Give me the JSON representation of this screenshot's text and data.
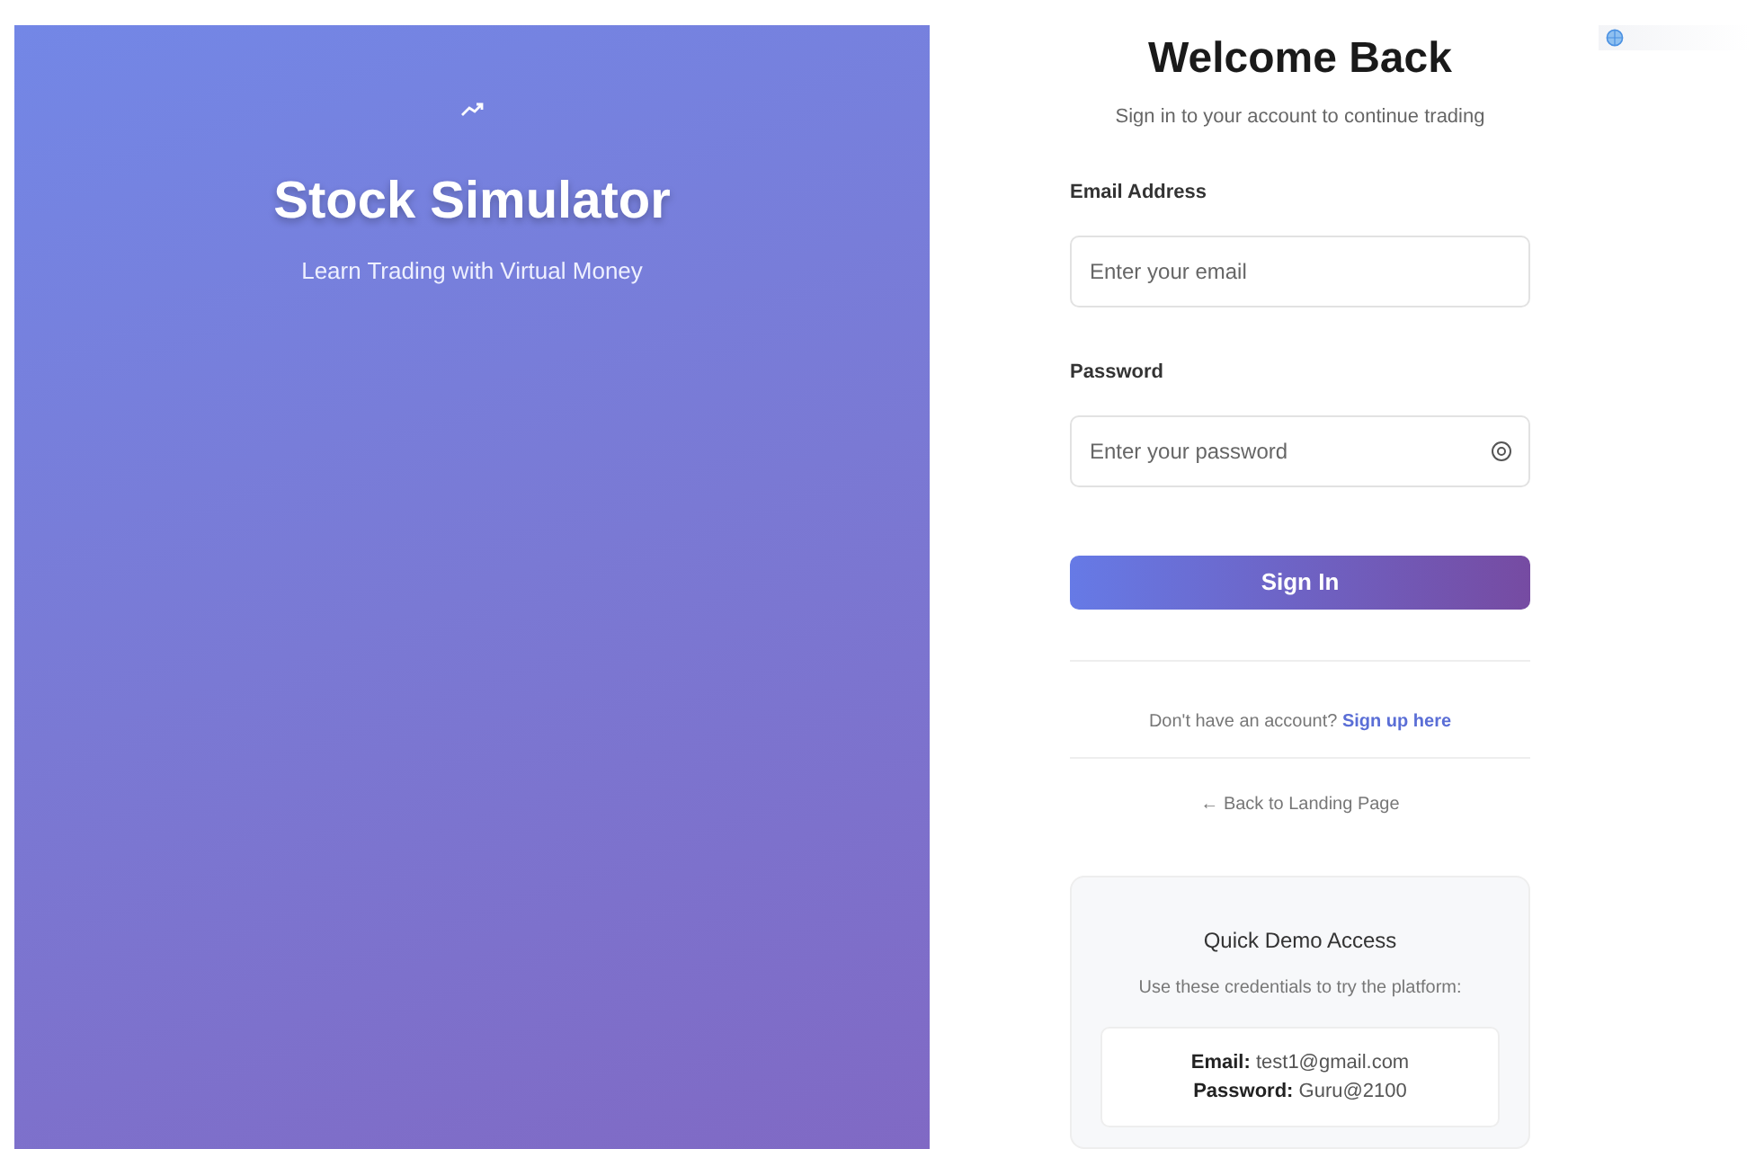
{
  "brand": {
    "title": "Stock Simulator",
    "tagline": "Learn Trading with Virtual Money"
  },
  "login": {
    "title": "Welcome Back",
    "subtitle": "Sign in to your account to continue trading",
    "fields": [
      {
        "label": "Email Address",
        "placeholder": "Enter your email",
        "kind": "email"
      },
      {
        "label": "Password",
        "placeholder": "Enter your password",
        "kind": "password"
      }
    ],
    "submit": "Sign In",
    "signup_prompt": "Don't have an account?",
    "signup_link": "Sign up here",
    "back_link": "← Back to Landing Page"
  },
  "demo": {
    "title": "Quick Demo Access",
    "subtitle": "Use these credentials to try the platform:",
    "credentials": [
      "**Email:** test1@gmail.com",
      "**Password:** Guru@2100"
    ]
  }
}
